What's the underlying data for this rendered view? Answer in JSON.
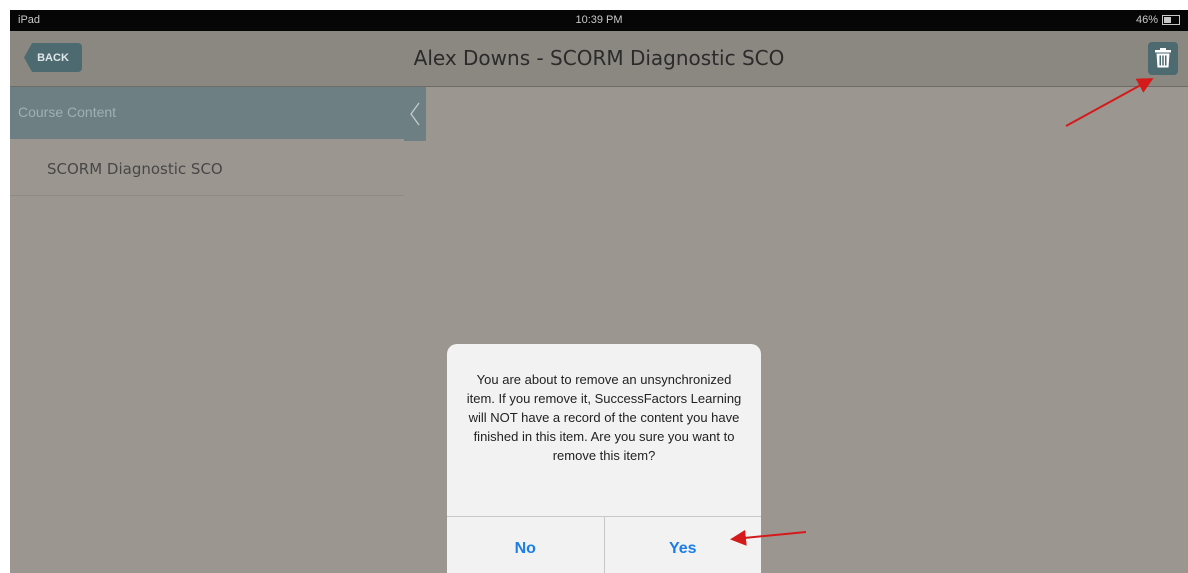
{
  "status_bar": {
    "carrier": "iPad",
    "time": "10:39 PM",
    "battery": "46%",
    "battery_level": 0.46
  },
  "nav": {
    "back_label": "BACK",
    "title": "Alex Downs - SCORM Diagnostic SCO",
    "trash_icon": "trash-icon"
  },
  "sidebar": {
    "header": "Course Content",
    "items": [
      {
        "label": "SCORM Diagnostic SCO"
      }
    ]
  },
  "dialog": {
    "message": "You are about to remove an unsynchronized item. If you remove it, SuccessFactors Learning will NOT have a record of the content you have finished in this item. Are you sure you want to remove this item?",
    "no_label": "No",
    "yes_label": "Yes"
  },
  "colors": {
    "navbar": "#8b8781",
    "content_bg": "#9b9790",
    "accent_button": "#4d6a70",
    "dialog_button_text": "#1a7ee8",
    "annotation_arrow": "#d41a1a"
  }
}
